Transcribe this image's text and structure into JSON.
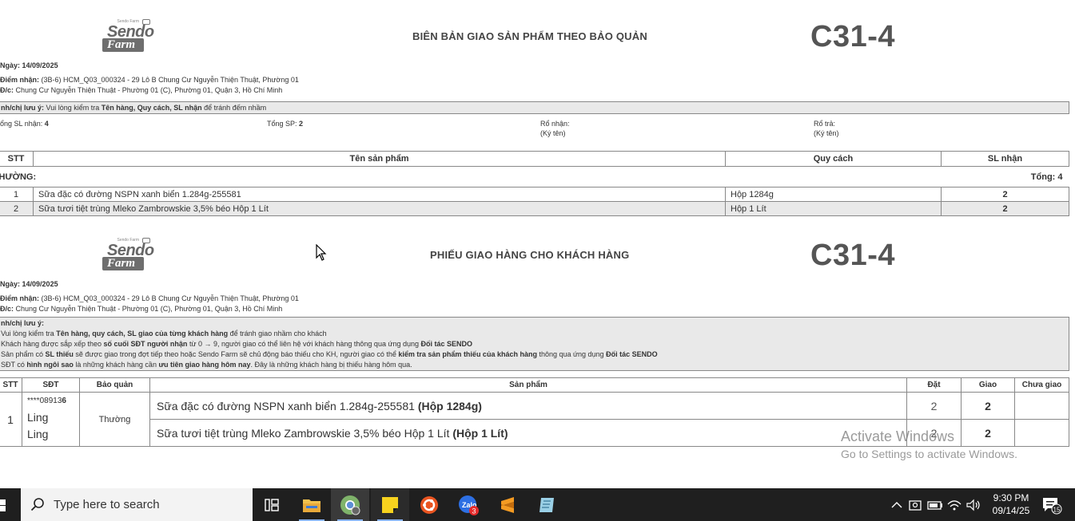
{
  "doc1": {
    "logo_small": "Sendo Farm",
    "logo_sendo": "Sendo",
    "logo_farm": "Farm",
    "title": "BIÊN BẢN GIAO SẢN PHẨM THEO BẢO QUẢN",
    "code": "C31-4",
    "date_label": "Ngày:",
    "date_value": "14/09/2025",
    "receive_label": "Điểm nhận:",
    "receive_value": "(3B-6) HCM_Q03_000324 - 29 Lô B Chung Cư Nguyễn Thiện Thuật, Phường 01",
    "address_label": "Đ/c:",
    "address_value": "Chung Cư Nguyễn Thiện Thuật - Phường 01 (C), Phường 01, Quận 3, Hồ Chí Minh",
    "note_label": "nh/chị lưu ý:",
    "note_pre": " Vui lòng kiểm tra ",
    "note_bold": "Tên hàng, Quy cách, SL nhận",
    "note_post": " để tránh đếm nhầm",
    "total_received_label": "ổng SL nhận:",
    "total_received_value": "4",
    "total_sp_label": "Tổng SP:",
    "total_sp_value": "2",
    "basket_receive_label": "Rổ nhận:",
    "basket_receive_sign": "(Ký tên)",
    "basket_return_label": "Rổ trả:",
    "basket_return_sign": "(Ký tên)",
    "columns": [
      "STT",
      "Tên sản phẩm",
      "Quy cách",
      "SL nhận"
    ],
    "group_label": "HƯỜNG:",
    "group_total": "Tổng: 4",
    "rows": [
      {
        "stt": "1",
        "name": "Sữa đặc có đường NSPN xanh biển 1.284g-255581",
        "spec": "Hộp 1284g",
        "qty": "2"
      },
      {
        "stt": "2",
        "name": "Sữa tươi tiệt trùng Mleko Zambrowskie 3,5% béo Hộp 1 Lít",
        "spec": "Hộp 1 Lít",
        "qty": "2"
      }
    ]
  },
  "doc2": {
    "title": "PHIẾU GIAO HÀNG CHO KHÁCH HÀNG",
    "code": "C31-4",
    "date_label": "Ngày:",
    "date_value": "14/09/2025",
    "receive_label": "Điểm nhận:",
    "receive_value": "(3B-6) HCM_Q03_000324 - 29 Lô B Chung Cư Nguyễn Thiện Thuật, Phường 01",
    "address_label": "Đ/c:",
    "address_value": "Chung Cư Nguyễn Thiện Thuật - Phường 01 (C), Phường 01, Quận 3, Hồ Chí Minh",
    "notes_title": "nh/chị lưu ý:",
    "note1_a": " Vui lòng kiểm tra ",
    "note1_b": "Tên hàng, quy cách, SL giao của từng khách hàng",
    "note1_c": " để tránh giao nhầm cho khách",
    "note2_a": " Khách hàng được sắp xếp theo ",
    "note2_b": "số cuối SĐT người nhận",
    "note2_c": " từ 0 → 9, người giao có thể liên hệ với khách hàng thông qua ứng dụng ",
    "note2_d": "Đối tác SENDO",
    "note3_a": " Sản phẩm có ",
    "note3_b": "SL thiếu",
    "note3_c": " sẽ được giao trong đợt tiếp theo hoặc Sendo Farm sẽ chủ động báo thiếu cho KH, người giao có thể ",
    "note3_d": "kiểm tra sản phẩm thiếu của khách hàng",
    "note3_e": " thông qua ứng dụng ",
    "note3_f": "Đối tác SENDO",
    "note4_a": " SĐT có ",
    "note4_b": "hình ngôi sao",
    "note4_c": " là những khách hàng cần ",
    "note4_d": "ưu tiên giao hàng hôm nay",
    "note4_e": ". Đây là những khách hàng bị thiếu hàng hôm qua.",
    "columns": [
      "STT",
      "SĐT",
      "Bảo quản",
      "Sản phẩm",
      "Đặt",
      "Giao",
      "Chưa giao"
    ],
    "customer": {
      "stt": "1",
      "phone": "****08913",
      "phone_last": "6",
      "name_line1": "Ling",
      "name_line2": "Ling",
      "storage": "Thường"
    },
    "items": [
      {
        "name": "Sữa đặc có đường NSPN xanh biển 1.284g-255581 ",
        "spec": "(Hộp 1284g)",
        "ordered": "2",
        "delivered": "2",
        "pending": ""
      },
      {
        "name": "Sữa tươi tiệt trùng Mleko Zambrowskie 3,5% béo Hộp 1 Lít ",
        "spec": "(Hộp 1 Lít)",
        "ordered": "2",
        "delivered": "2",
        "pending": ""
      }
    ]
  },
  "watermark": {
    "line1": "Activate Windows",
    "line2": "Go to Settings to activate Windows."
  },
  "taskbar": {
    "search_placeholder": "Type here to search",
    "apps": [
      "task-view",
      "file-explorer",
      "chrome",
      "sticky-notes",
      "ubuntu",
      "zalo",
      "sublime",
      "notepad"
    ],
    "zalo_badge": "3",
    "time": "9:30 PM",
    "date": "09/14/25",
    "notification_count": "15"
  },
  "colors": {
    "taskbar_bg": "#1f1f1f",
    "note_bg": "#e9e9e9",
    "text": "#333333"
  }
}
